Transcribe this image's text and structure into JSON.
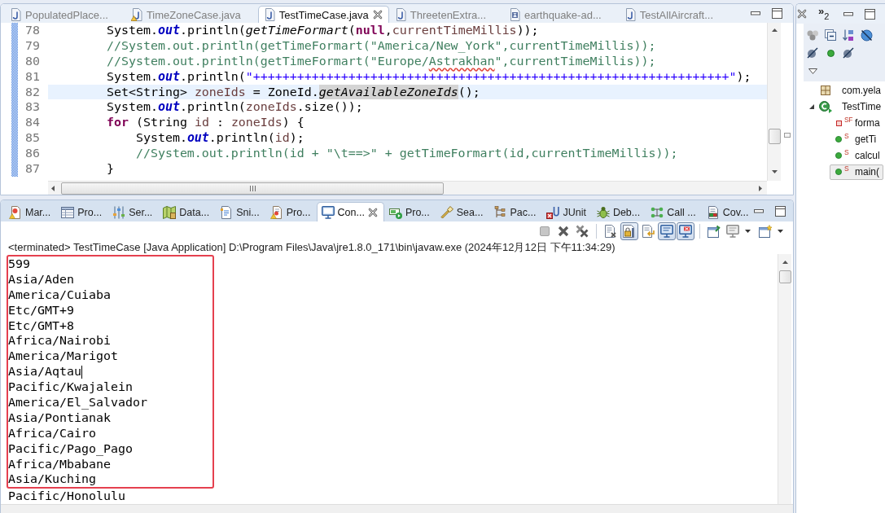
{
  "editor": {
    "tabs": [
      {
        "label": "PopulatedPlace...",
        "kind": "java",
        "warning": false,
        "selected": false
      },
      {
        "label": "TimeZoneCase.java",
        "kind": "java",
        "warning": true,
        "selected": false
      },
      {
        "label": "TestTimeCase.java",
        "kind": "java",
        "warning": false,
        "selected": true
      },
      {
        "label": "ThreetenExtra...",
        "kind": "java",
        "warning": false,
        "selected": false
      },
      {
        "label": "earthquake-ad...",
        "kind": "doc",
        "warning": false,
        "selected": false
      },
      {
        "label": "TestAllAircraft...",
        "kind": "java",
        "warning": false,
        "selected": false
      }
    ],
    "lines": [
      {
        "number": "78",
        "current": false,
        "segments": [
          {
            "text": "        System.",
            "kind": "plain"
          },
          {
            "text": "out",
            "kind": "field"
          },
          {
            "text": ".println(",
            "kind": "plain"
          },
          {
            "text": "getTimeFormart",
            "kind": "method"
          },
          {
            "text": "(",
            "kind": "plain"
          },
          {
            "text": "null",
            "kind": "keyword"
          },
          {
            "text": ",",
            "kind": "plain"
          },
          {
            "text": "currentTimeMillis",
            "kind": "var"
          },
          {
            "text": "));",
            "kind": "plain"
          }
        ]
      },
      {
        "number": "79",
        "current": false,
        "segments": [
          {
            "text": "        //System.out.println(getTimeFormart(\"America/New_York\",currentTimeMillis));",
            "kind": "comment"
          }
        ]
      },
      {
        "number": "80",
        "current": false,
        "segments": [
          {
            "text": "        //System.out.println(getTimeFormart(\"Europe/",
            "kind": "comment"
          },
          {
            "text": "Astrakhan",
            "kind": "spelling"
          },
          {
            "text": "\",currentTimeMillis));",
            "kind": "comment"
          }
        ]
      },
      {
        "number": "81",
        "current": false,
        "segments": [
          {
            "text": "        System.",
            "kind": "plain"
          },
          {
            "text": "out",
            "kind": "field"
          },
          {
            "text": ".println(",
            "kind": "plain"
          },
          {
            "text": "\"+++++++++++++++++++++++++++++++++++++++++++++++++++++++++++++++++\"",
            "kind": "string"
          },
          {
            "text": ");",
            "kind": "plain"
          }
        ]
      },
      {
        "number": "82",
        "current": true,
        "segments": [
          {
            "text": "        Set<String> ",
            "kind": "plain"
          },
          {
            "text": "zoneIds",
            "kind": "var"
          },
          {
            "text": " = ZoneId.",
            "kind": "plain"
          },
          {
            "text": "getAvailableZoneIds",
            "kind": "occurrence"
          },
          {
            "text": "();",
            "kind": "plain"
          }
        ]
      },
      {
        "number": "83",
        "current": false,
        "segments": [
          {
            "text": "        System.",
            "kind": "plain"
          },
          {
            "text": "out",
            "kind": "field"
          },
          {
            "text": ".println(",
            "kind": "plain"
          },
          {
            "text": "zoneIds",
            "kind": "var"
          },
          {
            "text": ".size());",
            "kind": "plain"
          }
        ]
      },
      {
        "number": "84",
        "current": false,
        "segments": [
          {
            "text": "        for",
            "kind": "keyword"
          },
          {
            "text": " (String ",
            "kind": "plain"
          },
          {
            "text": "id",
            "kind": "var"
          },
          {
            "text": " : ",
            "kind": "plain"
          },
          {
            "text": "zoneIds",
            "kind": "var"
          },
          {
            "text": ") {",
            "kind": "plain"
          }
        ]
      },
      {
        "number": "85",
        "current": false,
        "segments": [
          {
            "text": "            System.",
            "kind": "plain"
          },
          {
            "text": "out",
            "kind": "field"
          },
          {
            "text": ".println(",
            "kind": "plain"
          },
          {
            "text": "id",
            "kind": "var"
          },
          {
            "text": ");",
            "kind": "plain"
          }
        ]
      },
      {
        "number": "86",
        "current": false,
        "segments": [
          {
            "text": "            //System.out.println(id + \"\\t==>\" + getTimeFormart(id,currentTimeMillis));",
            "kind": "comment"
          }
        ]
      },
      {
        "number": "87",
        "current": false,
        "segments": [
          {
            "text": "        }",
            "kind": "plain"
          }
        ]
      }
    ]
  },
  "console": {
    "tabs": [
      {
        "label": "Mar...",
        "kind": "markers",
        "selected": false
      },
      {
        "label": "Pro...",
        "kind": "properties",
        "selected": false
      },
      {
        "label": "Ser...",
        "kind": "servers",
        "selected": false
      },
      {
        "label": "Data...",
        "kind": "data",
        "selected": false
      },
      {
        "label": "Sni...",
        "kind": "snippets",
        "selected": false
      },
      {
        "label": "Pro...",
        "kind": "problems",
        "selected": false
      },
      {
        "label": "Con...",
        "kind": "console",
        "selected": true
      },
      {
        "label": "Pro...",
        "kind": "progress",
        "selected": false
      },
      {
        "label": "Sea...",
        "kind": "search",
        "selected": false
      },
      {
        "label": "Pac...",
        "kind": "packages",
        "selected": false
      },
      {
        "label": "JUnit",
        "kind": "junit",
        "selected": false
      },
      {
        "label": "Deb...",
        "kind": "debug",
        "selected": false
      },
      {
        "label": "Call ...",
        "kind": "call",
        "selected": false
      },
      {
        "label": "Cov...",
        "kind": "coverage",
        "selected": false
      }
    ],
    "toolbar": [
      [
        {
          "kind": "terminate",
          "pressed": false,
          "menu": false
        },
        {
          "kind": "remove",
          "pressed": false,
          "menu": false
        },
        {
          "kind": "remove-all",
          "pressed": false,
          "menu": false
        }
      ],
      [
        {
          "kind": "clear",
          "pressed": false,
          "menu": false
        },
        {
          "kind": "scroll-lock",
          "pressed": true,
          "menu": false
        },
        {
          "kind": "word-wrap",
          "pressed": false,
          "menu": false
        },
        {
          "kind": "stdout",
          "pressed": true,
          "menu": false
        },
        {
          "kind": "stderr",
          "pressed": true,
          "menu": false
        }
      ],
      [
        {
          "kind": "pin",
          "pressed": false,
          "menu": false
        },
        {
          "kind": "display",
          "pressed": false,
          "menu": true
        },
        {
          "kind": "open",
          "pressed": false,
          "menu": true
        }
      ]
    ],
    "status": "<terminated> TestTimeCase [Java Application] D:\\Program Files\\Java\\jre1.8.0_171\\bin\\javaw.exe (2024年12月12日 下午11:34:29)",
    "output": [
      {
        "kind": "highlighted",
        "lines": [
          {
            "text": "599",
            "caret": false
          },
          {
            "text": "Asia/Aden",
            "caret": false
          },
          {
            "text": "America/Cuiaba",
            "caret": false
          },
          {
            "text": "Etc/GMT+9",
            "caret": false
          },
          {
            "text": "Etc/GMT+8",
            "caret": false
          },
          {
            "text": "Africa/Nairobi",
            "caret": false
          },
          {
            "text": "America/Marigot",
            "caret": false
          },
          {
            "text": "Asia/Aqtau",
            "caret": true
          },
          {
            "text": "Pacific/Kwajalein",
            "caret": false
          },
          {
            "text": "America/El_Salvador",
            "caret": false
          },
          {
            "text": "Asia/Pontianak",
            "caret": false
          },
          {
            "text": "Africa/Cairo",
            "caret": false
          },
          {
            "text": "Pacific/Pago_Pago",
            "caret": false
          },
          {
            "text": "Africa/Mbabane",
            "caret": false
          },
          {
            "text": "Asia/Kuching",
            "caret": false
          }
        ]
      },
      {
        "kind": "plain",
        "lines": [
          {
            "text": "Pacific/Honolulu",
            "caret": false
          }
        ]
      }
    ]
  },
  "outline": {
    "overflow": {
      "chevron": "»",
      "count": "2"
    },
    "tree": [
      {
        "label": "com.yela",
        "kind": "package",
        "expanded": false,
        "selected": false
      },
      {
        "label": "TestTime",
        "kind": "class",
        "expanded": true,
        "selected": false,
        "children": [
          {
            "label": "forma",
            "kind": "field",
            "modifiers": "SF",
            "expanded": false,
            "selected": false
          },
          {
            "label": "getTi",
            "kind": "method",
            "modifiers": "S",
            "expanded": false,
            "selected": false
          },
          {
            "label": "calcul",
            "kind": "method",
            "modifiers": "S",
            "expanded": false,
            "selected": false
          },
          {
            "label": "main(",
            "kind": "method",
            "modifiers": "S",
            "expanded": false,
            "selected": true
          }
        ]
      }
    ]
  }
}
